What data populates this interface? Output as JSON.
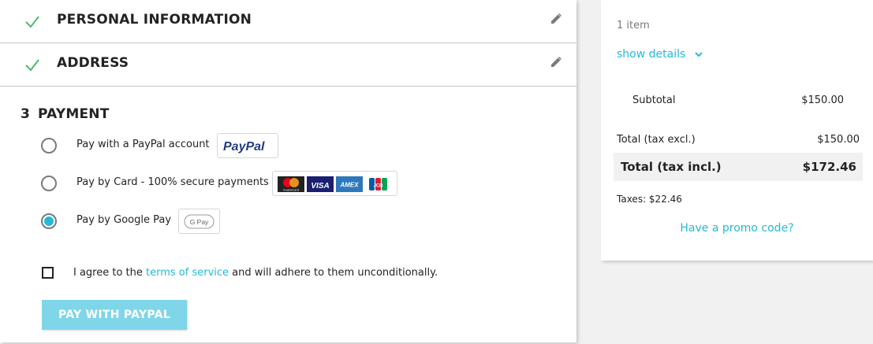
{
  "steps": {
    "personal": {
      "title": "PERSONAL INFORMATION"
    },
    "address": {
      "title": "ADDRESS"
    },
    "payment": {
      "number": "3",
      "title": "PAYMENT"
    }
  },
  "payment_options": [
    {
      "label": "Pay with a PayPal account",
      "selected": false,
      "logo": "PayPal"
    },
    {
      "label": "Pay by Card - 100% secure payments",
      "selected": false,
      "logos": [
        "mastercard",
        "VISA",
        "AMEX",
        "JCB"
      ]
    },
    {
      "label": "Pay by Google Pay",
      "selected": true,
      "logo": "G Pay"
    }
  ],
  "terms": {
    "prefix": "I agree to the ",
    "link": "terms of service",
    "suffix": " and will adhere to them unconditionally.",
    "checked": false
  },
  "pay_button": {
    "label": "PAY WITH PAYPAL"
  },
  "summary": {
    "items_count": "1 item",
    "show_details": "show details",
    "subtotal_label": "Subtotal",
    "subtotal_value": "$150.00",
    "total_excl_label": "Total (tax excl.)",
    "total_excl_value": "$150.00",
    "total_incl_label": "Total (tax incl.)",
    "total_incl_value": "$172.46",
    "taxes": "Taxes: $22.46",
    "promo": "Have a promo code?"
  },
  "colors": {
    "accent": "#25b9d7",
    "check": "#4cbb6c",
    "button_disabled": "#7fd6e8",
    "paypal_dark": "#253b80",
    "paypal_light": "#179bd7"
  }
}
